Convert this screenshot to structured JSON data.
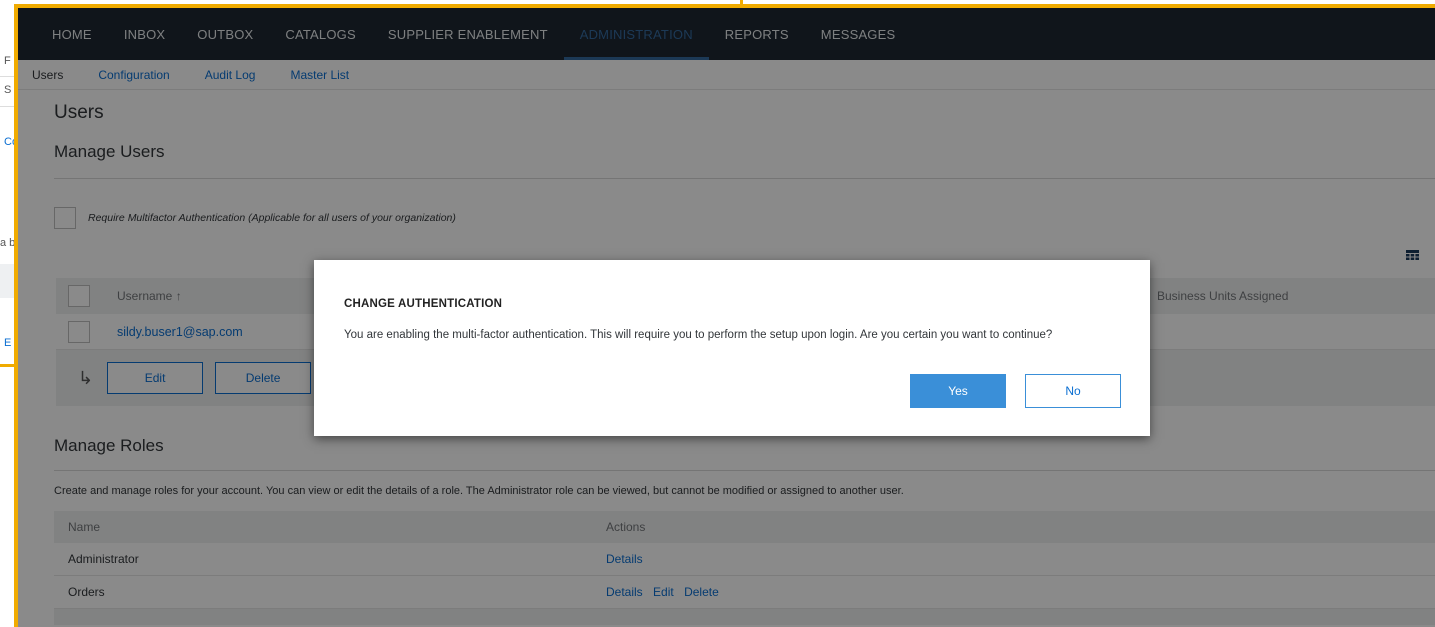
{
  "background_window": {
    "fragments": [
      "F",
      "S",
      "Co",
      "a be",
      "E"
    ]
  },
  "topnav": {
    "items": [
      "HOME",
      "INBOX",
      "OUTBOX",
      "CATALOGS",
      "SUPPLIER ENABLEMENT",
      "ADMINISTRATION",
      "REPORTS",
      "MESSAGES"
    ],
    "active": "ADMINISTRATION"
  },
  "subnav": {
    "items": [
      "Users",
      "Configuration",
      "Audit Log",
      "Master List"
    ],
    "active": "Users"
  },
  "page": {
    "title": "Users",
    "section_title": "Manage Users",
    "mfa_label": "Require Multifactor Authentication (Applicable for all users of your organization)"
  },
  "users_table": {
    "columns": {
      "username": "Username ↑",
      "business_units": "Business Units Assigned"
    },
    "rows": [
      {
        "username": "sildy.buser1@sap.com"
      }
    ],
    "actions": {
      "edit": "Edit",
      "delete": "Delete"
    }
  },
  "roles": {
    "title": "Manage Roles",
    "description": "Create and manage roles for your account. You can view or edit the details of a role. The Administrator role can be viewed, but cannot be modified or assigned to another user.",
    "columns": {
      "name": "Name",
      "actions": "Actions"
    },
    "rows": [
      {
        "name": "Administrator",
        "actions": [
          "Details"
        ]
      },
      {
        "name": "Orders",
        "actions": [
          "Details",
          "Edit",
          "Delete"
        ]
      }
    ]
  },
  "dialog": {
    "title": "CHANGE AUTHENTICATION",
    "message": "You are enabling the multi-factor authentication. This will require you to perform the setup upon login. Are you certain you want to continue?",
    "yes_label": "Yes",
    "no_label": "No"
  },
  "colors": {
    "frame": "#f0ab00",
    "nav_bg": "#1e2833",
    "nav_active": "#346aa0",
    "link": "#0a6ed1",
    "primary_button": "#3a8fd8"
  },
  "icons": {
    "table_settings": "table-settings-icon",
    "row_action_arrow": "arrow-down-right-icon"
  }
}
